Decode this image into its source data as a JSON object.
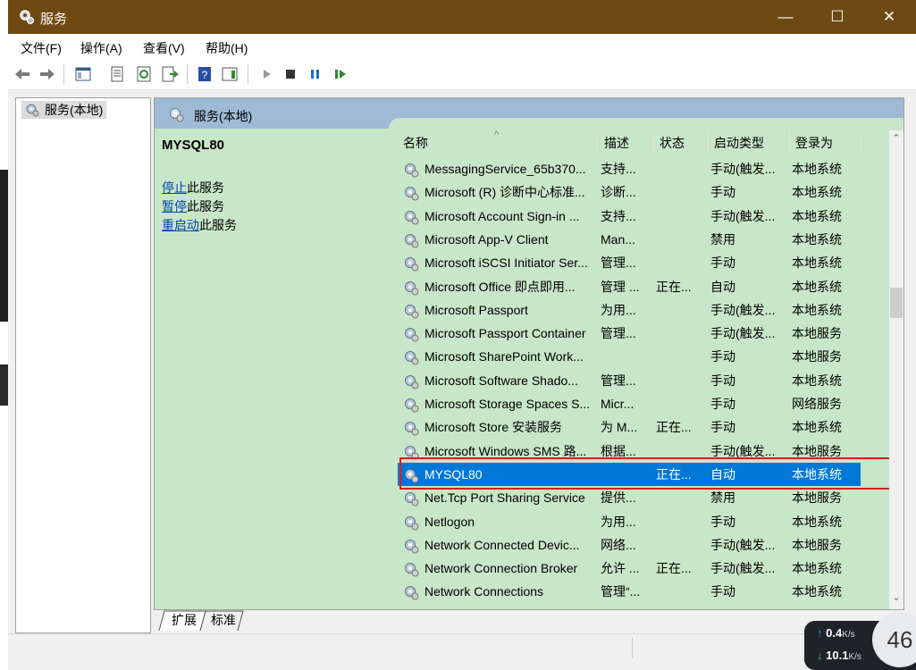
{
  "window": {
    "title": "服务",
    "minimize_glyph": "—",
    "maximize_glyph": "☐",
    "close_glyph": "✕"
  },
  "menu": [
    "文件(F)",
    "操作(A)",
    "查看(V)",
    "帮助(H)"
  ],
  "toolbar": {
    "icons": [
      "back-icon",
      "forward-icon",
      "show-hide-console-tree-icon",
      "properties-icon",
      "refresh-icon",
      "export-list-icon",
      "help-icon",
      "show-hide-action-pane-icon",
      "start-service-icon",
      "stop-service-icon",
      "pause-service-icon",
      "restart-service-icon"
    ]
  },
  "tree": {
    "root": "服务(本地)"
  },
  "pane": {
    "header": "服务(本地)",
    "extended": {
      "service_name": "MYSQL80",
      "actions": [
        {
          "link": "停止",
          "rest": "此服务"
        },
        {
          "link": "暂停",
          "rest": "此服务"
        },
        {
          "link": "重启动",
          "rest": "此服务"
        }
      ]
    }
  },
  "columns": [
    "名称",
    "描述",
    "状态",
    "启动类型",
    "登录为"
  ],
  "sort_indicator": "^",
  "services": [
    {
      "name": "MessagingService_65b370...",
      "desc": "支持...",
      "status": "",
      "startup": "手动(触发...",
      "logon": "本地系统"
    },
    {
      "name": "Microsoft (R) 诊断中心标准...",
      "desc": "诊断...",
      "status": "",
      "startup": "手动",
      "logon": "本地系统"
    },
    {
      "name": "Microsoft Account Sign-in ...",
      "desc": "支持...",
      "status": "",
      "startup": "手动(触发...",
      "logon": "本地系统"
    },
    {
      "name": "Microsoft App-V Client",
      "desc": "Man...",
      "status": "",
      "startup": "禁用",
      "logon": "本地系统"
    },
    {
      "name": "Microsoft iSCSI Initiator Ser...",
      "desc": "管理...",
      "status": "",
      "startup": "手动",
      "logon": "本地系统"
    },
    {
      "name": "Microsoft Office 即点即用...",
      "desc": "管理 ...",
      "status": "正在...",
      "startup": "自动",
      "logon": "本地系统"
    },
    {
      "name": "Microsoft Passport",
      "desc": "为用...",
      "status": "",
      "startup": "手动(触发...",
      "logon": "本地系统"
    },
    {
      "name": "Microsoft Passport Container",
      "desc": "管理...",
      "status": "",
      "startup": "手动(触发...",
      "logon": "本地服务"
    },
    {
      "name": "Microsoft SharePoint Work...",
      "desc": "",
      "status": "",
      "startup": "手动",
      "logon": "本地服务"
    },
    {
      "name": "Microsoft Software Shado...",
      "desc": "管理...",
      "status": "",
      "startup": "手动",
      "logon": "本地系统"
    },
    {
      "name": "Microsoft Storage Spaces S...",
      "desc": "Micr...",
      "status": "",
      "startup": "手动",
      "logon": "网络服务"
    },
    {
      "name": "Microsoft Store 安装服务",
      "desc": "为 M...",
      "status": "正在...",
      "startup": "手动",
      "logon": "本地系统"
    },
    {
      "name": "Microsoft Windows SMS 路...",
      "desc": "根据...",
      "status": "",
      "startup": "手动(触发...",
      "logon": "本地服务"
    },
    {
      "name": "MYSQL80",
      "desc": "",
      "status": "正在...",
      "startup": "自动",
      "logon": "本地系统",
      "selected": true
    },
    {
      "name": "Net.Tcp Port Sharing Service",
      "desc": "提供...",
      "status": "",
      "startup": "禁用",
      "logon": "本地服务"
    },
    {
      "name": "Netlogon",
      "desc": "为用...",
      "status": "",
      "startup": "手动",
      "logon": "本地系统"
    },
    {
      "name": "Network Connected Devic...",
      "desc": "网络...",
      "status": "",
      "startup": "手动(触发...",
      "logon": "本地服务"
    },
    {
      "name": "Network Connection Broker",
      "desc": "允许 ...",
      "status": "正在...",
      "startup": "手动(触发...",
      "logon": "本地系统"
    },
    {
      "name": "Network Connections",
      "desc": "管理“...",
      "status": "",
      "startup": "手动",
      "logon": "本地系统"
    }
  ],
  "tabs": [
    "扩展",
    "标准"
  ],
  "netmon": {
    "up": "0.4",
    "down": "10.1",
    "unit": "K/s",
    "gauge": "46"
  },
  "colors": {
    "titlebar": "#6e4a12",
    "pane": "#c8e6c8",
    "header": "#9ebad4",
    "selection": "#0078d7",
    "highlight": "#d32020"
  }
}
